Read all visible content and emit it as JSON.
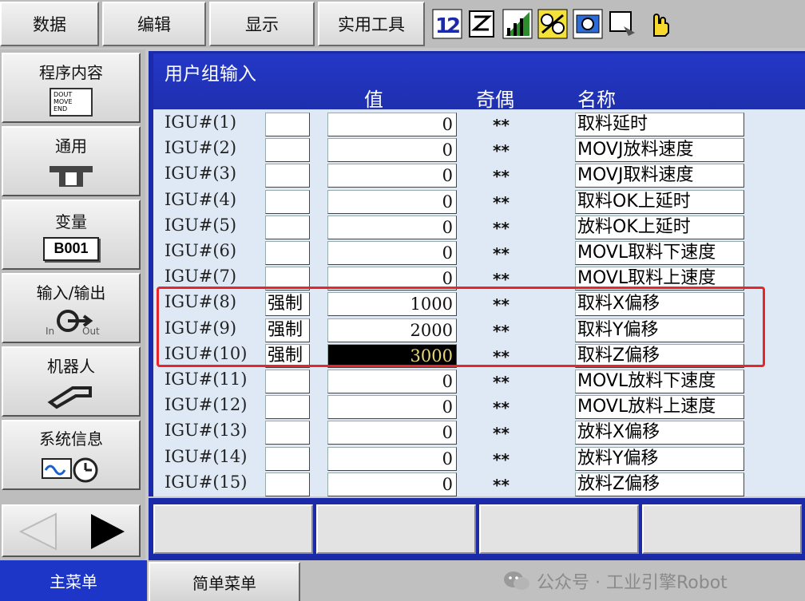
{
  "topmenu": {
    "data": "数据",
    "edit": "编辑",
    "display": "显示",
    "utility": "实用工具"
  },
  "toolbar_icons": [
    "mode-12-icon",
    "edit-doc-icon",
    "signal-bars-icon",
    "robot-group-icon",
    "camera-icon",
    "screen-edit-icon",
    "hand-pointer-icon"
  ],
  "sidebar": {
    "items": [
      {
        "label": "程序内容",
        "icon": "program-doc-icon",
        "icon_text": [
          "DOUT",
          "MOVE",
          "END"
        ]
      },
      {
        "label": "通用",
        "icon": "general-tool-icon"
      },
      {
        "label": "变量",
        "icon": "variable-box-icon",
        "icon_text": "B001"
      },
      {
        "label": "输入/输出",
        "icon": "io-plug-icon",
        "icon_in": "In",
        "icon_out": "Out"
      },
      {
        "label": "机器人",
        "icon": "robot-arm-icon"
      },
      {
        "label": "系统信息",
        "icon": "system-info-icon"
      }
    ]
  },
  "panel": {
    "title": "用户组输入",
    "col_value": "值",
    "col_parity": "奇偶",
    "col_name": "名称"
  },
  "rows": [
    {
      "index": "IGU#(1)",
      "force": "",
      "value": "0",
      "parity": "**",
      "name": "取料延时"
    },
    {
      "index": "IGU#(2)",
      "force": "",
      "value": "0",
      "parity": "**",
      "name": "MOVJ放料速度"
    },
    {
      "index": "IGU#(3)",
      "force": "",
      "value": "0",
      "parity": "**",
      "name": "MOVJ取料速度"
    },
    {
      "index": "IGU#(4)",
      "force": "",
      "value": "0",
      "parity": "**",
      "name": "取料OK上延时"
    },
    {
      "index": "IGU#(5)",
      "force": "",
      "value": "0",
      "parity": "**",
      "name": "放料OK上延时"
    },
    {
      "index": "IGU#(6)",
      "force": "",
      "value": "0",
      "parity": "**",
      "name": "MOVL取料下速度"
    },
    {
      "index": "IGU#(7)",
      "force": "",
      "value": "0",
      "parity": "**",
      "name": "MOVL取料上速度"
    },
    {
      "index": "IGU#(8)",
      "force": "强制",
      "value": "1000",
      "parity": "**",
      "name": "取料X偏移"
    },
    {
      "index": "IGU#(9)",
      "force": "强制",
      "value": "2000",
      "parity": "**",
      "name": "取料Y偏移"
    },
    {
      "index": "IGU#(10)",
      "force": "强制",
      "value": "3000",
      "parity": "**",
      "name": "取料Z偏移",
      "selected": true
    },
    {
      "index": "IGU#(11)",
      "force": "",
      "value": "0",
      "parity": "**",
      "name": "MOVL放料下速度"
    },
    {
      "index": "IGU#(12)",
      "force": "",
      "value": "0",
      "parity": "**",
      "name": "MOVL放料上速度"
    },
    {
      "index": "IGU#(13)",
      "force": "",
      "value": "0",
      "parity": "**",
      "name": "放料X偏移"
    },
    {
      "index": "IGU#(14)",
      "force": "",
      "value": "0",
      "parity": "**",
      "name": "放料Y偏移"
    },
    {
      "index": "IGU#(15)",
      "force": "",
      "value": "0",
      "parity": "**",
      "name": "放料Z偏移"
    }
  ],
  "bottom": {
    "main_menu": "主菜单",
    "simple_menu": "简单菜单",
    "watermark": "公众号 · 工业引擎Robot"
  },
  "colors": {
    "panel_blue": "#1a2aa8",
    "row_bg": "#dfe9f6",
    "highlight_red": "#e5262b",
    "selected_value_bg": "#000000",
    "selected_value_fg": "#e7d57a"
  }
}
